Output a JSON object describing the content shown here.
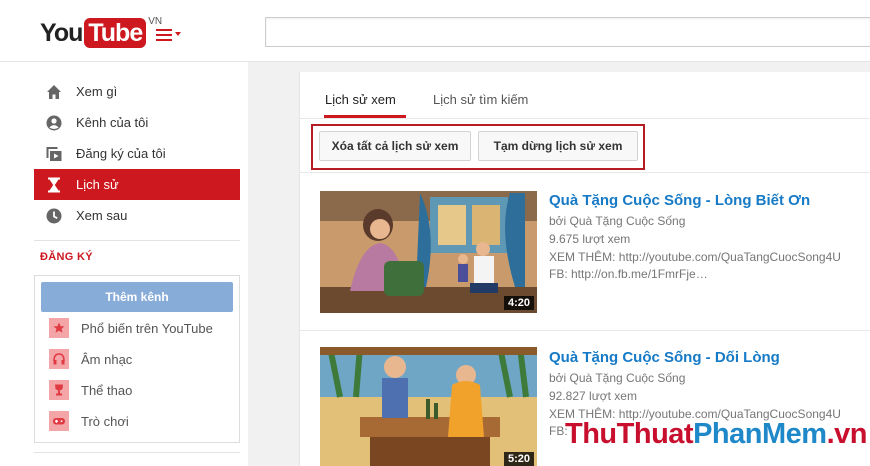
{
  "header": {
    "logo_you": "You",
    "logo_tube": "Tube",
    "logo_region": "VN",
    "search_placeholder": ""
  },
  "sidebar": {
    "nav": [
      {
        "label": "Xem gì",
        "icon": "home-icon"
      },
      {
        "label": "Kênh của tôi",
        "icon": "user-icon"
      },
      {
        "label": "Đăng ký của tôi",
        "icon": "subscriptions-icon"
      },
      {
        "label": "Lịch sử",
        "icon": "hourglass-icon",
        "active": true
      },
      {
        "label": "Xem sau",
        "icon": "clock-icon"
      }
    ],
    "subscriptions_title": "ĐĂNG KÝ",
    "add_channel": "Thêm kênh",
    "channels": [
      {
        "label": "Phổ biến trên YouTube",
        "icon": "star-icon"
      },
      {
        "label": "Âm nhạc",
        "icon": "headphones-icon"
      },
      {
        "label": "Thể thao",
        "icon": "trophy-icon"
      },
      {
        "label": "Trò chơi",
        "icon": "gamepad-icon"
      }
    ]
  },
  "main": {
    "tabs": [
      {
        "label": "Lịch sử xem",
        "active": true
      },
      {
        "label": "Lịch sử tìm kiếm",
        "active": false
      }
    ],
    "buttons": {
      "clear_all": "Xóa tất cả lịch sử xem",
      "pause": "Tạm dừng lịch sử xem"
    },
    "videos": [
      {
        "title": "Quà Tặng Cuộc Sống - Lòng Biết Ơn",
        "channel": "bởi Quà Tặng Cuộc Sống",
        "views": "9.675 lượt xem",
        "desc1": "XEM THÊM: http://youtube.com/QuaTangCuocSong4U",
        "desc2": "FB: http://on.fb.me/1FmrFje…",
        "duration": "4:20"
      },
      {
        "title": "Quà Tặng Cuộc Sống - Dối Lòng",
        "channel": "bởi Quà Tặng Cuộc Sống",
        "views": "92.827 lượt xem",
        "desc1": "XEM THÊM: http://youtube.com/QuaTangCuocSong4U",
        "desc2": "FB:",
        "duration": "5:20"
      }
    ]
  },
  "watermark": {
    "part1": "ThuThuat",
    "part2": "PhanMem",
    "part3": ".vn"
  },
  "colors": {
    "brand_red": "#cc181e",
    "link_blue": "#167ac6",
    "add_button": "#88acd8"
  }
}
